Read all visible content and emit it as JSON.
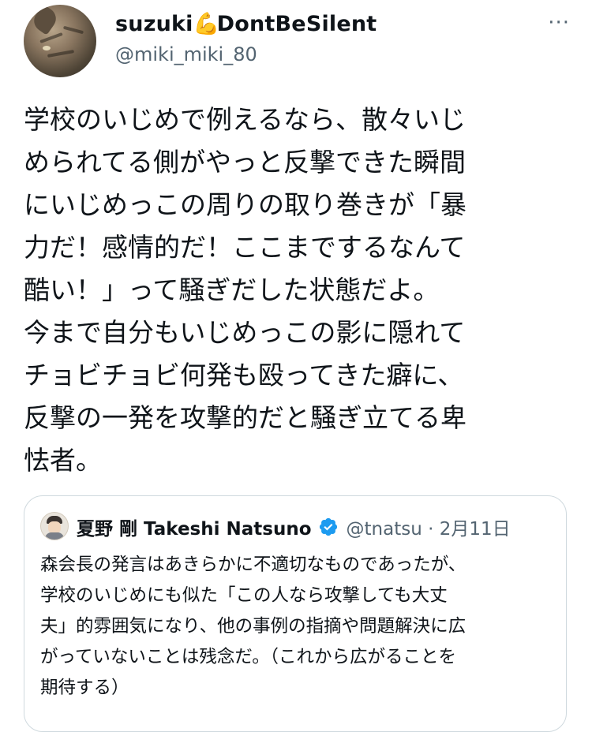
{
  "tweet": {
    "author_name": "suzuki",
    "author_emoji": "💪",
    "author_name_suffix": "DontBeSilent",
    "author_handle": "@miki_miki_80",
    "more_label": "···",
    "text": "学校のいじめで例えるなら、散々いじ\nめられてる側がやっと反撃できた瞬間\nにいじめっこの周りの取り巻きが「暴\n力だ！感情的だ！ここまでするなんて\n酷い！」って騒ぎだした状態だよ。\n今まで自分もいじめっこの影に隠れて\nチョビチョビ何発も殴ってきた癖に、\n反撃の一発を攻撃的だと騒ぎ立てる卑\n怯者。"
  },
  "quoted_tweet": {
    "author_name": "夏野 剛 Takeshi Natsuno",
    "verified_icon": "verified-badge-icon",
    "author_handle": "@tnatsu",
    "separator": "·",
    "date": "2月11日",
    "text": "森会長の発言はあきらかに不適切なものであったが、\n学校のいじめにも似た「この人なら攻撃しても大丈\n夫」的雰囲気になり、他の事例の指摘や問題解決に広\nがっていないことは残念だ。（これから広がることを\n期待する）"
  },
  "colors": {
    "text": "#0f1419",
    "secondary": "#536471",
    "border": "#cfd9de",
    "verified": "#1d9bf0"
  }
}
